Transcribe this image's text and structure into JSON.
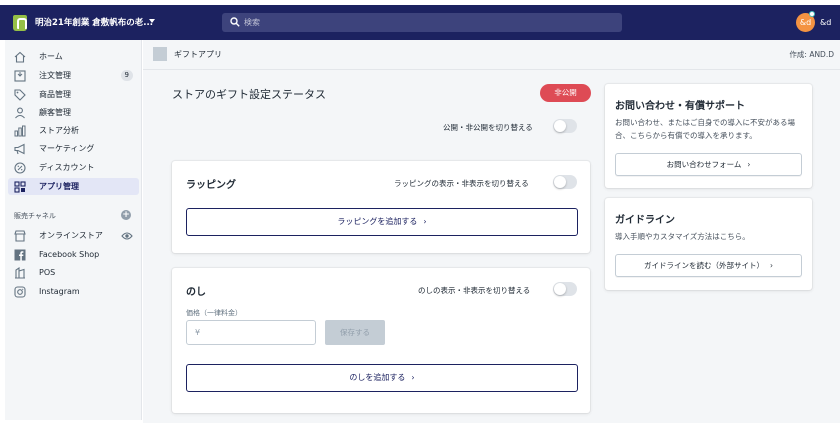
{
  "topbar": {
    "store_name": "明治21年創業 倉敷帆布の老...",
    "search_placeholder": "検索",
    "avatar_initials": "&d",
    "user_name": "&d"
  },
  "sidebar": {
    "items": [
      {
        "label": "ホーム",
        "icon": "home-icon"
      },
      {
        "label": "注文管理",
        "icon": "orders-icon",
        "badge": "9"
      },
      {
        "label": "商品管理",
        "icon": "tag-icon"
      },
      {
        "label": "顧客管理",
        "icon": "customer-icon"
      },
      {
        "label": "ストア分析",
        "icon": "analytics-icon"
      },
      {
        "label": "マーケティング",
        "icon": "megaphone-icon"
      },
      {
        "label": "ディスカウント",
        "icon": "discount-icon"
      },
      {
        "label": "アプリ管理",
        "icon": "apps-icon",
        "active": true
      }
    ],
    "channels_heading": "販売チャネル",
    "channels": [
      {
        "label": "オンラインストア",
        "icon": "store-icon"
      },
      {
        "label": "Facebook Shop",
        "icon": "facebook-icon"
      },
      {
        "label": "POS",
        "icon": "pos-icon"
      },
      {
        "label": "Instagram",
        "icon": "instagram-icon"
      }
    ]
  },
  "header": {
    "page_title": "ギフトアプリ",
    "author": "作成: AND.D"
  },
  "status": {
    "title": "ストアのギフト設定ステータス",
    "badge": "非公開",
    "toggle_label": "公開・非公開を切り替える"
  },
  "wrapping": {
    "title": "ラッピング",
    "toggle_label": "ラッピングの表示・非表示を切り替える",
    "add_button": "ラッピングを追加する"
  },
  "noshi": {
    "title": "のし",
    "toggle_label": "のしの表示・非表示を切り替える",
    "price_label": "価格（一律料金）",
    "price_prefix": "¥",
    "save_button": "保存する",
    "add_button": "のしを追加する"
  },
  "support": {
    "title": "お問い合わせ・有償サポート",
    "text": "お問い合わせ、またはご自身での導入に不安がある場合、こちらから有償での導入を承ります。",
    "button": "お問い合わせフォーム"
  },
  "guide": {
    "title": "ガイドライン",
    "text": "導入手順やカスタマイズ方法はこちら。",
    "button": "ガイドラインを読む（外部サイト）"
  },
  "colors": {
    "topbar": "#1c2260",
    "badge_red": "#de4b55",
    "accent": "#1c2260"
  }
}
